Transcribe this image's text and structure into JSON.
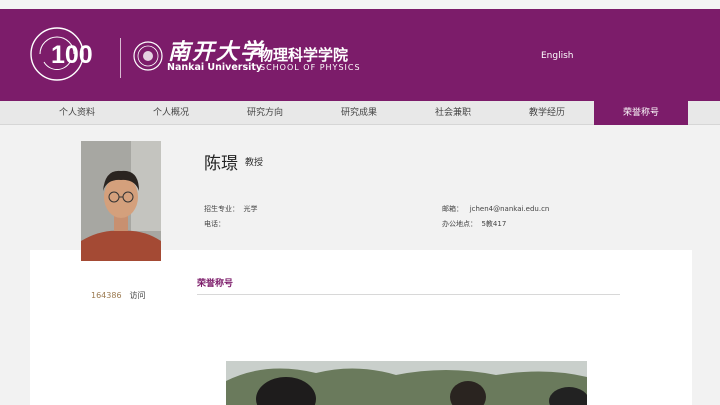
{
  "header": {
    "logo_number": "100",
    "calligraphy": "南开大学",
    "school_cn": "物理科学学院",
    "university_en": "Nankai University",
    "school_en": "SCHOOL OF PHYSICS",
    "language_link": "English",
    "brand_color": "#7c1c6a"
  },
  "nav": {
    "items": [
      {
        "label": "个人资料"
      },
      {
        "label": "个人概况"
      },
      {
        "label": "研究方向"
      },
      {
        "label": "研究成果"
      },
      {
        "label": "社会兼职"
      },
      {
        "label": "教学经历"
      },
      {
        "label": "荣誉称号"
      }
    ],
    "active": "荣誉称号"
  },
  "profile": {
    "name": "陈璟",
    "title": "教授",
    "major_label": "招生专业：",
    "major_value": "光学",
    "phone_label": "电话：",
    "phone_value": "",
    "email_label": "邮箱：",
    "email_value": "jchen4@nankai.edu.cn",
    "office_label": "办公地点：",
    "office_value": "5教417"
  },
  "visits": {
    "count": "164386",
    "label": "访问"
  },
  "section": {
    "title": "荣誉称号"
  }
}
